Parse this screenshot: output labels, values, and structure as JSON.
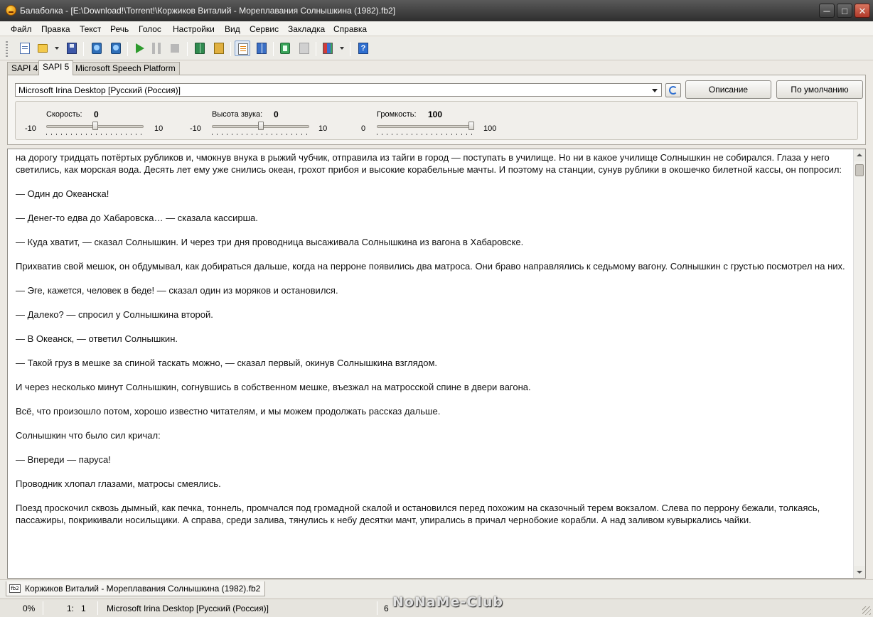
{
  "window": {
    "title": "Балаболка - [E:\\Download!\\Torrent!\\Коржиков Виталий - Мореплавания Солнышкина (1982).fb2]",
    "controls": {
      "minimize": "─",
      "maximize": "□",
      "close": "✕"
    }
  },
  "menu": [
    "Файл",
    "Правка",
    "Текст",
    "Речь",
    "Голос",
    "Настройки",
    "Вид",
    "Сервис",
    "Закладка",
    "Справка"
  ],
  "toolbar": {
    "buttons": [
      "new-document-icon",
      "open-folder-icon",
      "save-icon",
      "save-audio-icon",
      "convert-audio-icon",
      "play-icon",
      "pause-icon",
      "stop-icon",
      "read-book-icon",
      "library-icon",
      "clipboard-reader-icon",
      "book-reader-icon",
      "split-icon",
      "disabled-icon",
      "color-icon",
      "help-icon"
    ],
    "help_glyph": "?"
  },
  "engine_tabs": [
    "SAPI 4",
    "SAPI 5",
    "Microsoft Speech Platform"
  ],
  "engine_tab_selected": "SAPI 5",
  "voice": {
    "selected": "Microsoft Irina Desktop [Русский (Россия)]",
    "describe_button": "Описание",
    "default_button": "По умолчанию"
  },
  "sliders": {
    "rate": {
      "label": "Скорость:",
      "value": "0",
      "min": "-10",
      "max": "10",
      "level": 0.5
    },
    "pitch": {
      "label": "Высота звука:",
      "value": "0",
      "min": "-10",
      "max": "10",
      "level": 0.5
    },
    "volume": {
      "label": "Громкость:",
      "value": "100",
      "min": "0",
      "max": "100",
      "level": 1.0
    }
  },
  "document": {
    "paragraphs": [
      "на дорогу тридцать потёртых рубликов и, чмокнув внука в рыжий чубчик, отправила из тайги в город — поступать в училище. Но ни в какое училище Солнышкин не собирался. Глаза у него светились, как морская вода. Десять лет ему уже снились океан, грохот прибоя и высокие корабельные мачты. И поэтому на станции, сунув рублики в окошечко билетной кассы, он попросил:",
      "— Один до Океанска!",
      "— Денег-то едва до Хабаровска… — сказала кассирша.",
      "— Куда хватит, — сказал Солнышкин. И через три дня проводница высаживала Солнышкина из вагона в Хабаровске.",
      "Прихватив свой мешок, он обдумывал, как добираться дальше, когда на перроне появились два матроса. Они браво направлялись к седьмому вагону. Солнышкин с грустью посмотрел на них.",
      "— Эге, кажется, человек в беде! — сказал один из моряков и остановился.",
      "— Далеко? — спросил у Солнышкина второй.",
      "— В Океанск, — ответил Солнышкин.",
      "— Такой груз в мешке за спиной таскать можно, — сказал первый, окинув Солнышкина взглядом.",
      "И через несколько минут Солнышкин, согнувшись в собственном мешке, въезжал на матросской спине в двери вагона.",
      "Всё, что произошло потом, хорошо известно читателям, и мы можем продолжать рассказ дальше.",
      "Солнышкин что было сил кричал:",
      "— Впереди — паруса!",
      "Проводник хлопал глазами, матросы смеялись.",
      "Поезд проскочил сквозь дымный, как печка, тоннель, промчался под громадной скалой и остановился перед похожим на сказочный терем вокзалом. Слева по перрону бежали, толкаясь, пассажиры, покрикивали носильщики. А справа, среди залива, тянулись к небу десятки мачт, упирались в причал чернобокие корабли. А над заливом кувыркались чайки."
    ]
  },
  "file_tab": {
    "icon_text": "fb2",
    "label": "Коржиков Виталий - Мореплавания Солнышкина (1982).fb2"
  },
  "status": {
    "progress": "0%",
    "position": "1:   1",
    "voice": "Microsoft Irina Desktop [Русский (Россия)]",
    "extra": "6"
  },
  "watermark": "NoNaMe-Club"
}
